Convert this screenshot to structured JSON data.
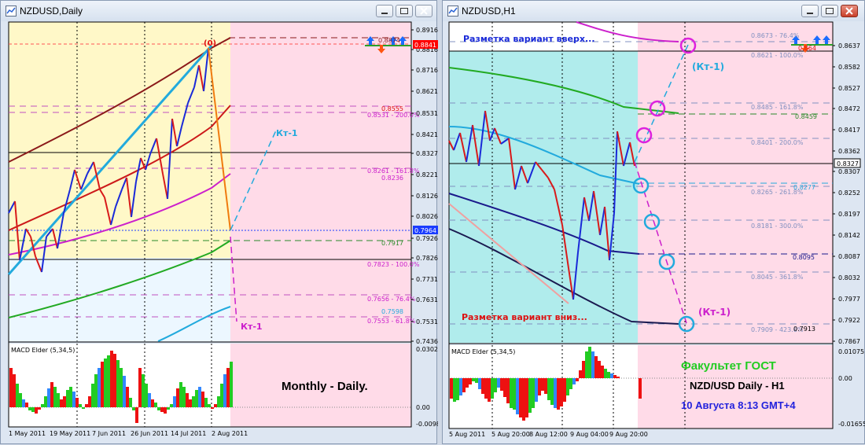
{
  "window_left": {
    "title": "NZDUSD,Daily",
    "macd_label": "MACD Elder (5,34,5)",
    "macd_scale": [
      "0.0302",
      "0.00",
      "-0.00986"
    ],
    "price_scale": [
      "0.8916",
      "0.8816",
      "0.8716",
      "0.8621",
      "0.8531",
      "0.8421",
      "0.8327",
      "0.8221",
      "0.8126",
      "0.8026",
      "0.7926",
      "0.7826",
      "0.7731",
      "0.7631",
      "0.7531",
      "0.7436"
    ],
    "price_tags": [
      {
        "text": "0.8841",
        "color": "#ff0000"
      },
      {
        "text": "0.7964",
        "color": "#1a3cff"
      }
    ],
    "level_labels": [
      "0.8874",
      "0.8555",
      "0.8531 - 200.0%",
      "0.8261 - 161.8%",
      "0.8236",
      "0.7917",
      "0.7823 - 100.0%",
      "0.7656 - 76.4%",
      "0.7598",
      "0.7553 - 61.8%"
    ],
    "annotations": {
      "kt_top": "Кт-1",
      "kt_bottom": "Кт-1",
      "peak_marker": "(0)",
      "overlay": "Monthly - Daily."
    },
    "dates": [
      "1 May 2011",
      "19 May 2011",
      "7 Jun 2011",
      "26 Jun 2011",
      "14 Jul 2011",
      "2 Aug 2011"
    ]
  },
  "window_right": {
    "title": "NZDUSD,H1",
    "macd_label": "MACD Elder (5,34,5)",
    "macd_scale": [
      "0.01075",
      "0.00",
      "-0.01655"
    ],
    "price_scale": [
      "0.8637",
      "0.8582",
      "0.8527",
      "0.8472",
      "0.8417",
      "0.8362",
      "0.8307",
      "0.8252",
      "0.8197",
      "0.8142",
      "0.8087",
      "0.8032",
      "0.7977",
      "0.7922",
      "0.7867"
    ],
    "price_tags": [
      {
        "text": "0.8327",
        "color": "#000000"
      }
    ],
    "level_labels": [
      "0.8673 - 76.4%",
      "0.8621 - 100.0%",
      "0.8485 - 161.8%",
      "0.8459",
      "0.8401 - 200.0%",
      "0.8277",
      "0.8265 - 261.8%",
      "0.8181 - 300.0%",
      "0.8095",
      "0.8045 - 361.8%",
      "0.7909 - 423.6%",
      "0.7913",
      "0.864"
    ],
    "annotations": {
      "variant_up": "Разметка вариант вверх...",
      "variant_down": "Разметка вариант вниз...",
      "kt_top": "(Кт-1)",
      "kt_bottom": "(Кт-1)",
      "faculty": "Факультет ГОСТ",
      "pair": "NZD/USD Daily - H1",
      "date": "10 Августа 8:13 GMT+4"
    },
    "dates": [
      "5 Aug 2011",
      "5 Aug 20:00",
      "8 Aug 12:00",
      "9 Aug 04:00",
      "9 Aug 20:00"
    ]
  },
  "colors": {
    "pink_zone": "#ffdbe8",
    "yellow_zone": "#fff8c8",
    "cyan_zone": "#b0ecec",
    "lightblue_zone": "#ecf7ff",
    "green_text": "#22cc22",
    "blue_text": "#2222dd"
  }
}
